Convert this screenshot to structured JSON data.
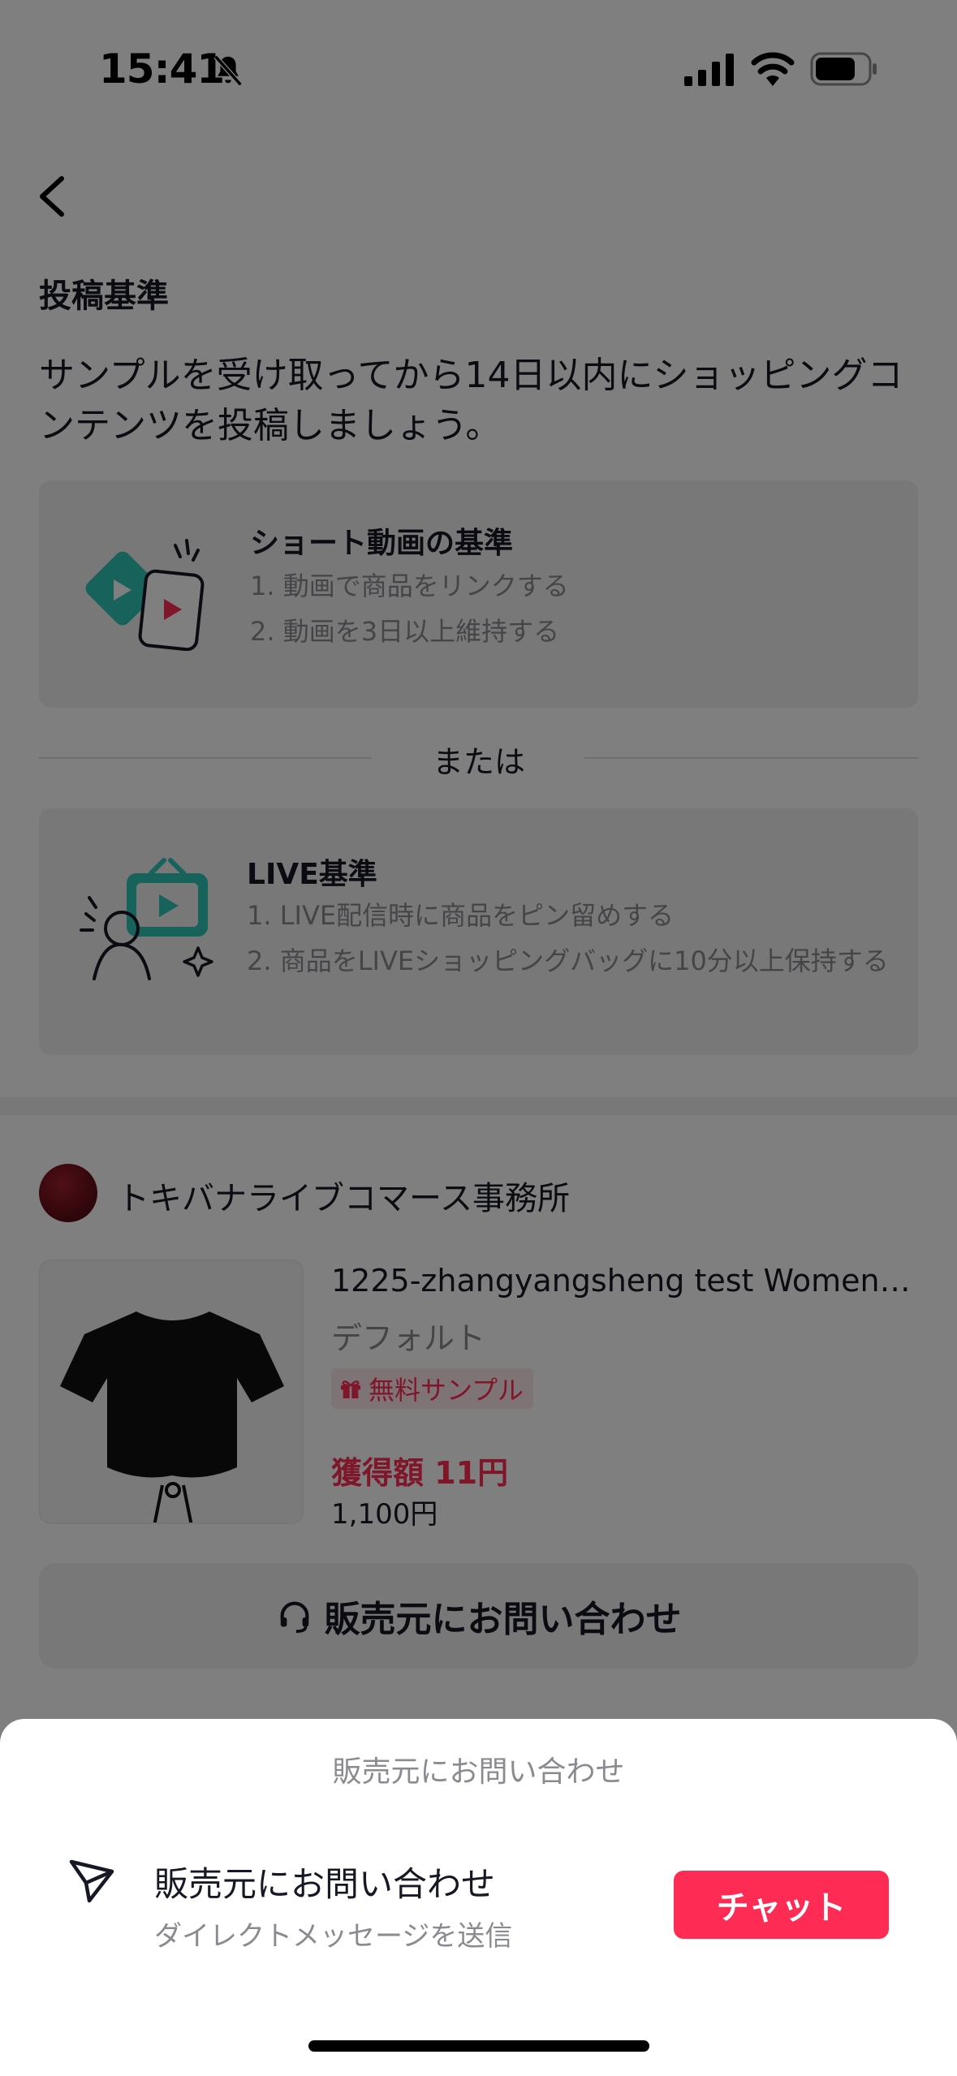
{
  "status_bar": {
    "time": "15:41"
  },
  "criteria": {
    "heading": "投稿基準",
    "intro": "サンプルを受け取ってから14日以内にショッピングコンテンツを投稿しましょう。",
    "short_video": {
      "title": "ショート動画の基準",
      "items": [
        "1. 動画で商品をリンクする",
        "2. 動画を3日以上維持する"
      ]
    },
    "divider": "または",
    "live": {
      "title": "LIVE基準",
      "items": [
        "1. LIVE配信時に商品をピン留めする",
        "2. 商品をLIVEショッピングバッグに10分以上保持する"
      ]
    }
  },
  "shop": {
    "name": "トキバナライブコマース事務所"
  },
  "product": {
    "title": "1225-zhangyangsheng test Women's...",
    "variant": "デフォルト",
    "badge": "無料サンプル",
    "earn": "獲得額 11円",
    "price": "1,100円"
  },
  "contact_button": {
    "label": "販売元にお問い合わせ"
  },
  "sheet": {
    "title": "販売元にお問い合わせ",
    "option_title": "販売元にお問い合わせ",
    "option_subtitle": "ダイレクトメッセージを送信",
    "chat_label": "チャット"
  },
  "colors": {
    "accent": "#fe2c55",
    "text": "#161823",
    "muted": "#8a8b91",
    "card_bg": "#f1f1f2"
  },
  "icons": [
    "bell-slash-icon",
    "signal-icon",
    "wifi-icon",
    "battery-icon",
    "back-arrow-icon",
    "video-illustration-icon",
    "live-illustration-icon",
    "gift-icon",
    "headset-icon",
    "send-icon"
  ]
}
